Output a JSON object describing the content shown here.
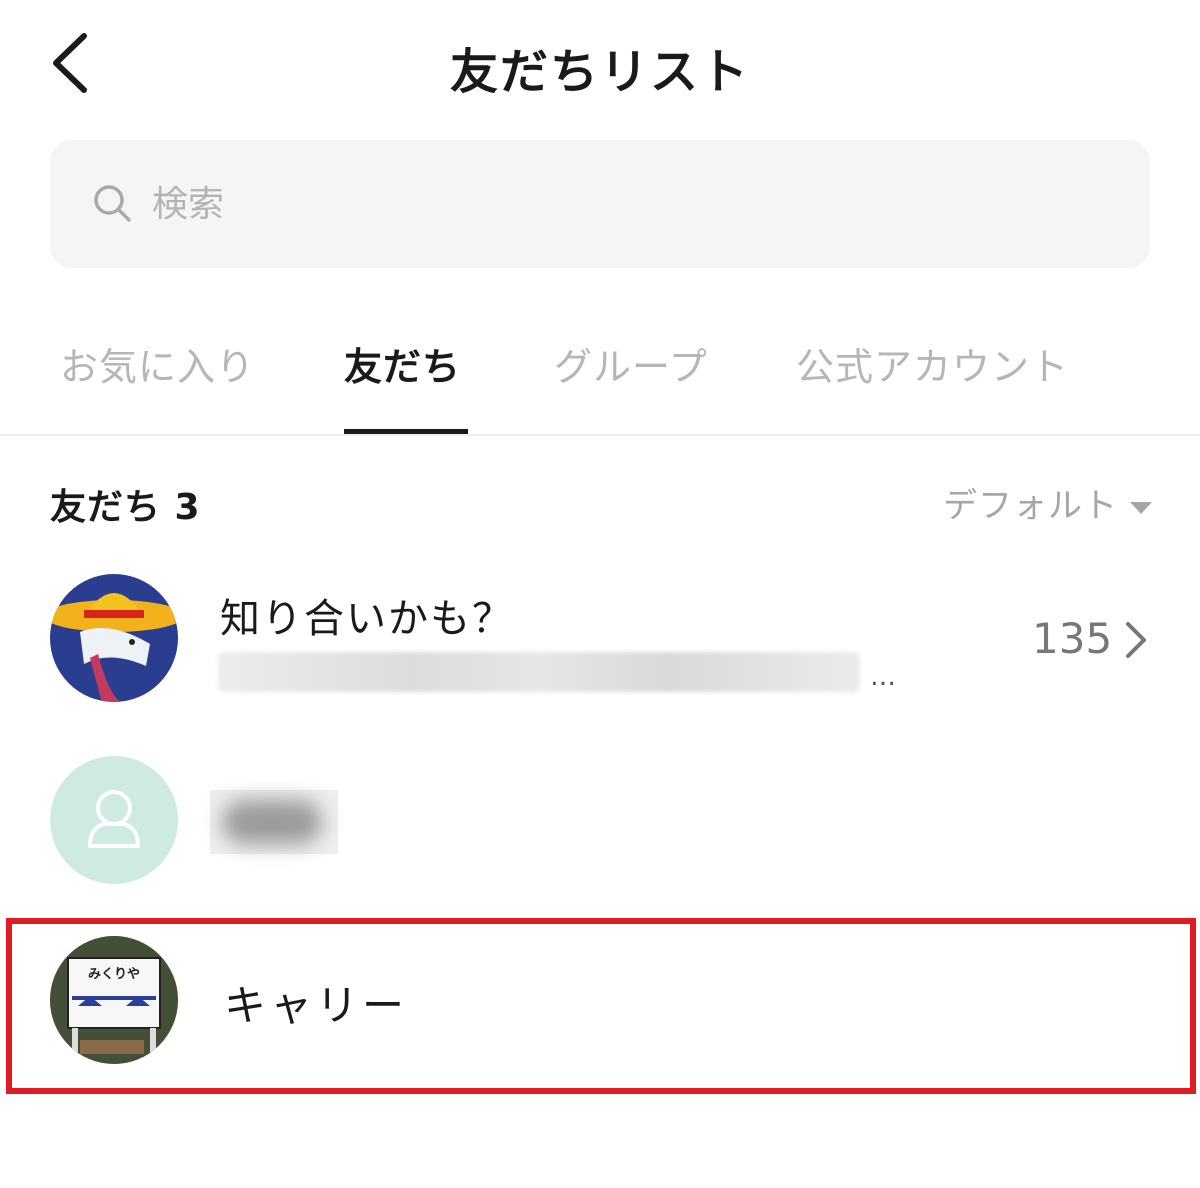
{
  "header": {
    "title": "友だちリスト"
  },
  "search": {
    "placeholder": "検索"
  },
  "tabs": [
    {
      "label": "お気に入り",
      "active": false
    },
    {
      "label": "友だち",
      "active": true
    },
    {
      "label": "グループ",
      "active": false
    },
    {
      "label": "公式アカウント",
      "active": false
    }
  ],
  "friends_section": {
    "title": "友だち 3",
    "sort_label": "デフォルト"
  },
  "recommend_row": {
    "name": "知り合いかも？",
    "ellipsis": "…",
    "count": "135"
  },
  "friends": [
    {
      "name": "キャリー",
      "highlighted": true,
      "avatar_sign_text": "みくりや"
    }
  ],
  "colors": {
    "highlight": "#e01c22",
    "default_avatar": "#cfe9e3",
    "tab_active": "#1a1a1a",
    "tab_inactive": "#b6b6b6"
  }
}
